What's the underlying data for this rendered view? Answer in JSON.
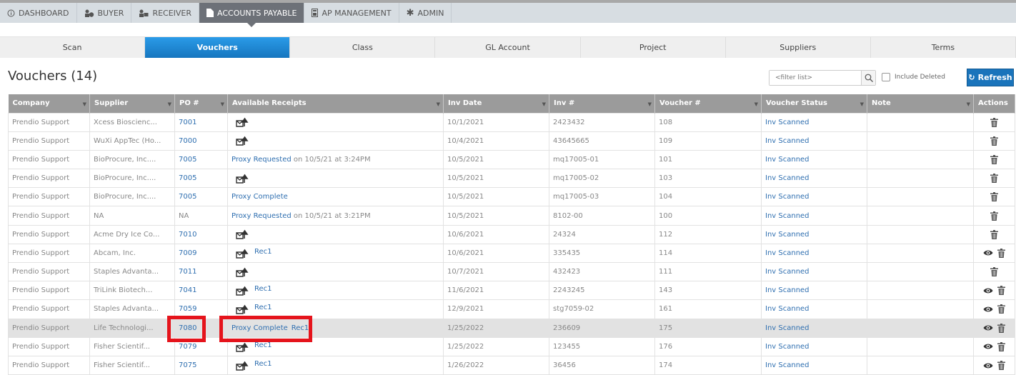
{
  "main_nav": [
    {
      "label": "DASHBOARD",
      "icon": "info-circle-icon",
      "active": false
    },
    {
      "label": "BUYER",
      "icon": "buyer-icon",
      "active": false
    },
    {
      "label": "RECEIVER",
      "icon": "receiver-icon",
      "active": false
    },
    {
      "label": "ACCOUNTS PAYABLE",
      "icon": "document-dollar-icon",
      "active": true
    },
    {
      "label": "AP MANAGEMENT",
      "icon": "calculator-icon",
      "active": false
    },
    {
      "label": "ADMIN",
      "icon": "gear-icon",
      "active": false
    }
  ],
  "sub_nav": [
    {
      "label": "Scan",
      "active": false
    },
    {
      "label": "Vouchers",
      "active": true
    },
    {
      "label": "Class",
      "active": false
    },
    {
      "label": "GL Account",
      "active": false
    },
    {
      "label": "Project",
      "active": false
    },
    {
      "label": "Suppliers",
      "active": false
    },
    {
      "label": "Terms",
      "active": false
    }
  ],
  "page_title": "Vouchers (14)",
  "filter": {
    "placeholder": "<filter list>",
    "value": ""
  },
  "include_deleted": {
    "label": "Include Deleted",
    "checked": false
  },
  "refresh_label": "Refresh",
  "colors": {
    "accent": "#1a74bb",
    "link": "#2f6fb0",
    "header": "#9b9b9b",
    "highlight": "#e5141c"
  },
  "columns": [
    "Company",
    "Supplier",
    "PO #",
    "Available Receipts",
    "Inv Date",
    "Inv #",
    "Voucher #",
    "Voucher Status",
    "Note",
    "Actions"
  ],
  "rows": [
    {
      "company": "Prendio Support",
      "supplier": "Xcess Bioscienc...",
      "po": "7001",
      "upload": true,
      "proxy": "",
      "proxy_note": "",
      "rec": "",
      "inv_date": "10/1/2021",
      "inv_no": "2423432",
      "voucher": "108",
      "status": "Inv Scanned",
      "note": "",
      "view": false
    },
    {
      "company": "Prendio Support",
      "supplier": "WuXi AppTec (Ho...",
      "po": "7000",
      "upload": true,
      "proxy": "",
      "proxy_note": "",
      "rec": "",
      "inv_date": "10/4/2021",
      "inv_no": "43645665",
      "voucher": "109",
      "status": "Inv Scanned",
      "note": "",
      "view": false
    },
    {
      "company": "Prendio Support",
      "supplier": "BioProcure, Inc....",
      "po": "7005",
      "upload": false,
      "proxy": "Proxy Requested",
      "proxy_note": " on 10/5/21 at 3:24PM",
      "rec": "",
      "inv_date": "10/5/2021",
      "inv_no": "mq17005-01",
      "voucher": "101",
      "status": "Inv Scanned",
      "note": "",
      "view": false
    },
    {
      "company": "Prendio Support",
      "supplier": "BioProcure, Inc....",
      "po": "7005",
      "upload": true,
      "proxy": "",
      "proxy_note": "",
      "rec": "",
      "inv_date": "10/5/2021",
      "inv_no": "mq17005-02",
      "voucher": "103",
      "status": "Inv Scanned",
      "note": "",
      "view": false
    },
    {
      "company": "Prendio Support",
      "supplier": "BioProcure, Inc....",
      "po": "7005",
      "upload": false,
      "proxy": "Proxy Complete",
      "proxy_note": "",
      "rec": "",
      "inv_date": "10/5/2021",
      "inv_no": "mq17005-03",
      "voucher": "104",
      "status": "Inv Scanned",
      "note": "",
      "view": false
    },
    {
      "company": "Prendio Support",
      "supplier": "NA",
      "po": "NA",
      "upload": false,
      "proxy": "Proxy Requested",
      "proxy_note": " on 10/5/21 at 3:21PM",
      "rec": "",
      "inv_date": "10/5/2021",
      "inv_no": "8102-00",
      "voucher": "100",
      "status": "Inv Scanned",
      "note": "",
      "view": false
    },
    {
      "company": "Prendio Support",
      "supplier": "Acme Dry Ice Co...",
      "po": "7010",
      "upload": true,
      "proxy": "",
      "proxy_note": "",
      "rec": "",
      "inv_date": "10/6/2021",
      "inv_no": "24324",
      "voucher": "112",
      "status": "Inv Scanned",
      "note": "",
      "view": false
    },
    {
      "company": "Prendio Support",
      "supplier": "Abcam, Inc.",
      "po": "7009",
      "upload": true,
      "proxy": "",
      "proxy_note": "",
      "rec": "Rec1",
      "inv_date": "10/6/2021",
      "inv_no": "335435",
      "voucher": "114",
      "status": "Inv Scanned",
      "note": "",
      "view": true
    },
    {
      "company": "Prendio Support",
      "supplier": "Staples Advanta...",
      "po": "7011",
      "upload": true,
      "proxy": "",
      "proxy_note": "",
      "rec": "",
      "inv_date": "10/7/2021",
      "inv_no": "432423",
      "voucher": "111",
      "status": "Inv Scanned",
      "note": "",
      "view": false
    },
    {
      "company": "Prendio Support",
      "supplier": "TriLink Biotech...",
      "po": "7041",
      "upload": true,
      "proxy": "",
      "proxy_note": "",
      "rec": "Rec1",
      "inv_date": "11/6/2021",
      "inv_no": "2243245",
      "voucher": "143",
      "status": "Inv Scanned",
      "note": "",
      "view": true
    },
    {
      "company": "Prendio Support",
      "supplier": "Staples Advanta...",
      "po": "7059",
      "upload": true,
      "proxy": "",
      "proxy_note": "",
      "rec": "Rec1",
      "inv_date": "12/9/2021",
      "inv_no": "stg7059-02",
      "voucher": "161",
      "status": "Inv Scanned",
      "note": "",
      "view": true
    },
    {
      "company": "Prendio Support",
      "supplier": "Life Technologi...",
      "po": "7080",
      "upload": false,
      "proxy": "Proxy Complete",
      "proxy_note": "",
      "rec": "Rec1",
      "inv_date": "1/25/2022",
      "inv_no": "236609",
      "voucher": "175",
      "status": "Inv Scanned",
      "note": "",
      "view": true,
      "highlighted": true
    },
    {
      "company": "Prendio Support",
      "supplier": "Fisher Scientif...",
      "po": "7079",
      "upload": true,
      "proxy": "",
      "proxy_note": "",
      "rec": "Rec1",
      "inv_date": "1/25/2022",
      "inv_no": "123455",
      "voucher": "176",
      "status": "Inv Scanned",
      "note": "",
      "view": true
    },
    {
      "company": "Prendio Support",
      "supplier": "Fisher Scientif...",
      "po": "7075",
      "upload": true,
      "proxy": "",
      "proxy_note": "",
      "rec": "Rec1",
      "inv_date": "1/26/2022",
      "inv_no": "36456",
      "voucher": "174",
      "status": "Inv Scanned",
      "note": "",
      "view": true
    }
  ]
}
